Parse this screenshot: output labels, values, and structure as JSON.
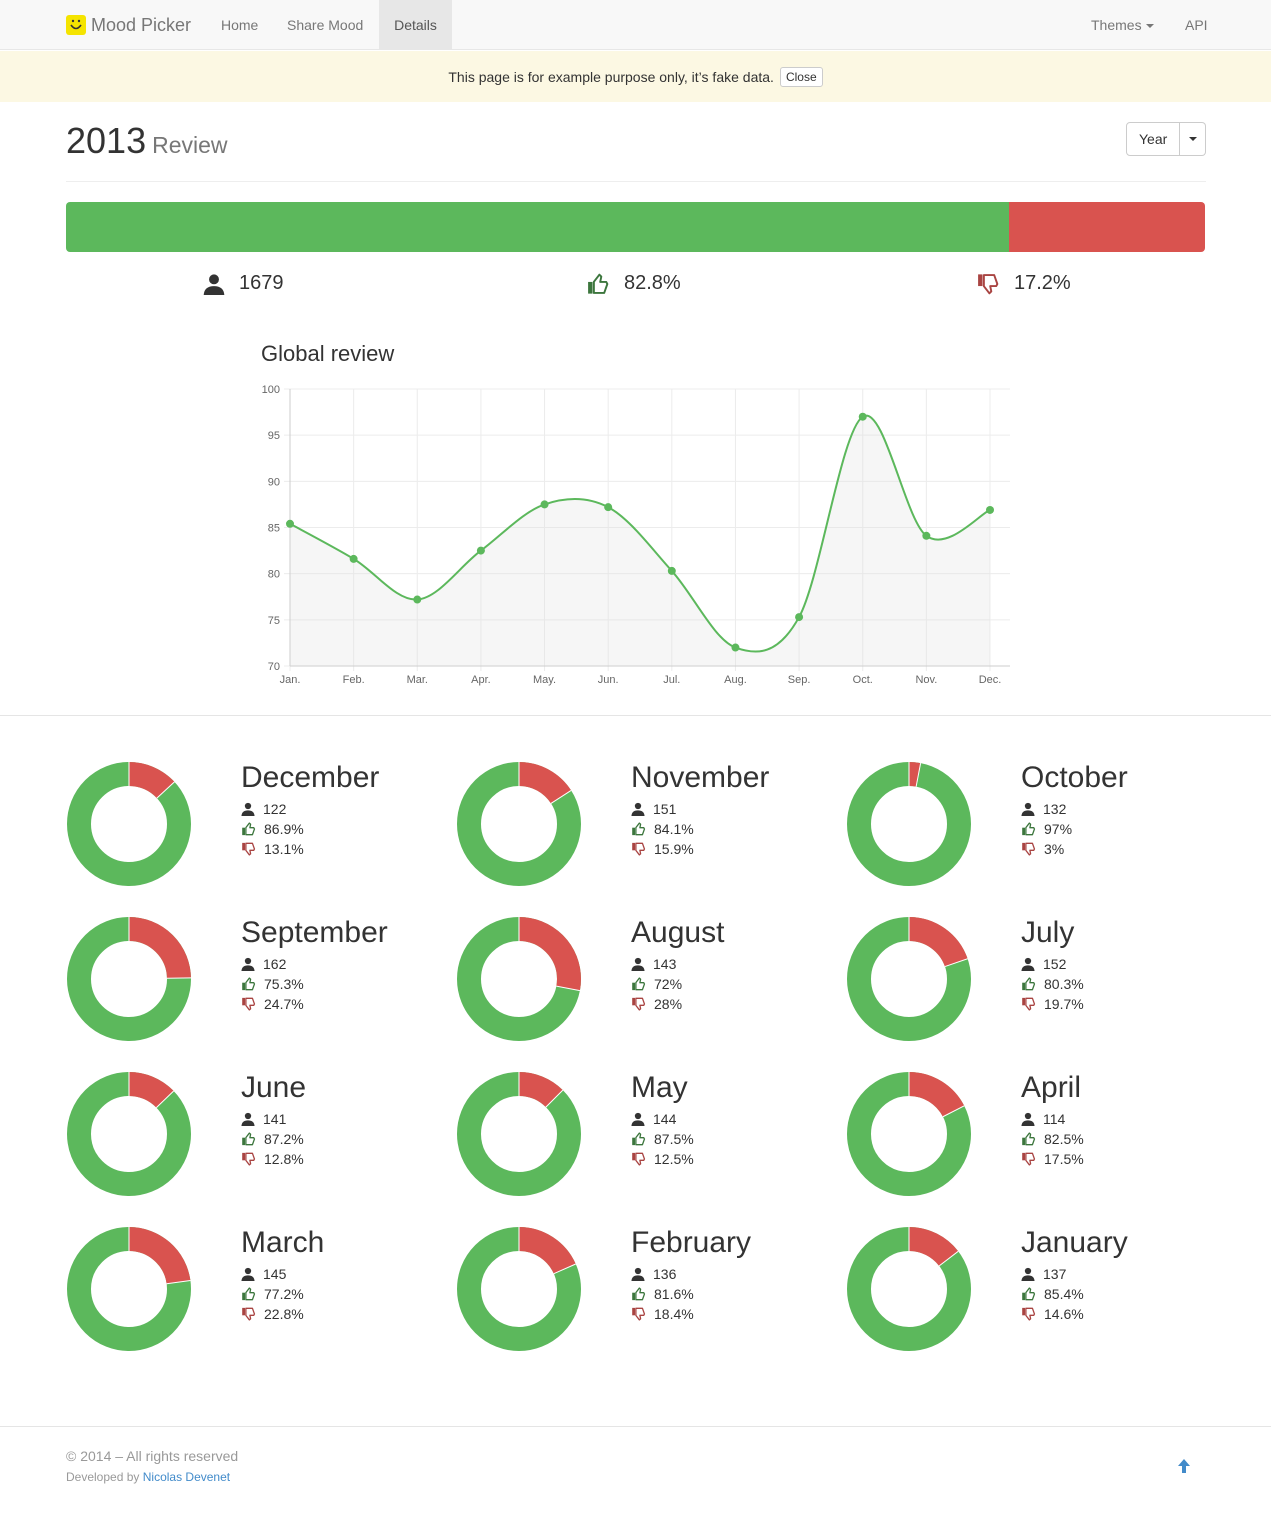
{
  "navbar": {
    "brand": "Mood Picker",
    "items": [
      {
        "label": "Home"
      },
      {
        "label": "Share Mood"
      },
      {
        "label": "Details"
      }
    ],
    "themes": "Themes",
    "api": "API"
  },
  "alert": {
    "text": "This page is for example purpose only, it’s fake data.",
    "close": "Close"
  },
  "header": {
    "year": "2013",
    "subtitle": "Review",
    "period_button": "Year"
  },
  "summary": {
    "users": "1679",
    "positive": "82.8%",
    "negative": "17.2%",
    "positive_fraction": 0.828,
    "colors": {
      "good": "#5cb85c",
      "bad": "#d9534f"
    }
  },
  "chart_data": {
    "type": "line",
    "title": "Global review",
    "categories": [
      "Jan.",
      "Feb.",
      "Mar.",
      "Apr.",
      "May.",
      "Jun.",
      "Jul.",
      "Aug.",
      "Sep.",
      "Oct.",
      "Nov.",
      "Dec."
    ],
    "values": [
      85.4,
      81.6,
      77.2,
      82.5,
      87.5,
      87.2,
      80.3,
      72,
      75.3,
      97,
      84.1,
      86.9
    ],
    "ylim": [
      70,
      100
    ],
    "yticks": [
      70,
      75,
      80,
      85,
      90,
      95,
      100
    ],
    "grid": true,
    "smooth": true,
    "fill": true,
    "color": "#5cb85c"
  },
  "months": [
    {
      "name": "December",
      "users": "122",
      "positive": "86.9%",
      "negative": "13.1%",
      "pos": 0.869
    },
    {
      "name": "November",
      "users": "151",
      "positive": "84.1%",
      "negative": "15.9%",
      "pos": 0.841
    },
    {
      "name": "October",
      "users": "132",
      "positive": "97%",
      "negative": "3%",
      "pos": 0.97
    },
    {
      "name": "September",
      "users": "162",
      "positive": "75.3%",
      "negative": "24.7%",
      "pos": 0.753
    },
    {
      "name": "August",
      "users": "143",
      "positive": "72%",
      "negative": "28%",
      "pos": 0.72
    },
    {
      "name": "July",
      "users": "152",
      "positive": "80.3%",
      "negative": "19.7%",
      "pos": 0.803
    },
    {
      "name": "June",
      "users": "141",
      "positive": "87.2%",
      "negative": "12.8%",
      "pos": 0.872
    },
    {
      "name": "May",
      "users": "144",
      "positive": "87.5%",
      "negative": "12.5%",
      "pos": 0.875
    },
    {
      "name": "April",
      "users": "114",
      "positive": "82.5%",
      "negative": "17.5%",
      "pos": 0.825
    },
    {
      "name": "March",
      "users": "145",
      "positive": "77.2%",
      "negative": "22.8%",
      "pos": 0.772
    },
    {
      "name": "February",
      "users": "136",
      "positive": "81.6%",
      "negative": "18.4%",
      "pos": 0.816
    },
    {
      "name": "January",
      "users": "137",
      "positive": "85.4%",
      "negative": "14.6%",
      "pos": 0.854
    }
  ],
  "footer": {
    "copyright": "© 2014 – All rights reserved",
    "developed_by": "Developed by",
    "author": "Nicolas Devenet"
  },
  "icons": {
    "user": "user-icon",
    "thumbs_up": "thumbs-up-icon",
    "thumbs_down": "thumbs-down-icon",
    "to_top": "arrow-up-icon",
    "logo": "smiley-logo-icon"
  }
}
